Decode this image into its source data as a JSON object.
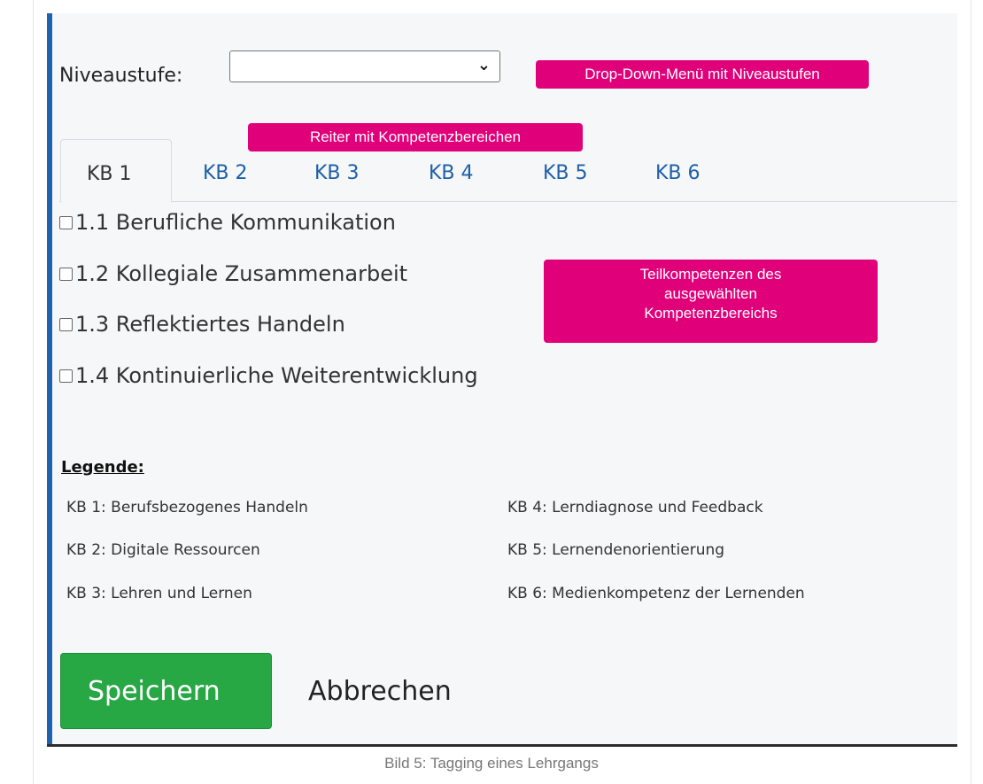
{
  "form": {
    "niveau_label": "Niveaustufe:",
    "niveau_selected": "",
    "tabs": [
      "KB 1",
      "KB 2",
      "KB 3",
      "KB 4",
      "KB 5",
      "KB 6"
    ],
    "active_tab": "KB 1",
    "competences": [
      "1.1 Berufliche Kommunikation",
      "1.2 Kollegiale Zusammenarbeit",
      "1.3 Reflektiertes Handeln",
      "1.4 Kontinuierliche Weiterentwicklung"
    ],
    "legend_title": "Legende:",
    "legend": [
      "KB 1: Berufsbezogenes Handeln",
      "KB 2: Digitale Ressourcen",
      "KB 3: Lehren und Lernen",
      "KB 4: Lerndiagnose und Feedback",
      "KB 5: Lernendenorientierung",
      "KB 6: Medienkompetenz der Lernenden"
    ],
    "save_label": "Speichern",
    "cancel_label": "Abbrechen"
  },
  "callouts": {
    "dropdown": "Drop-Down-Menü mit Niveaustufen",
    "tabs": "Reiter mit Kompetenzbereichen",
    "subcompetences_line1": "Teilkompetenzen des",
    "subcompetences_line2": "ausgewählten",
    "subcompetences_line3": "Kompetenzbereichs"
  },
  "caption": "Bild 5: Tagging eines Lehrgangs",
  "colors": {
    "callout": "#e0007a",
    "save_button": "#28a745",
    "tab_text": "#1f5fa8",
    "accent_bar": "#1f63b0"
  },
  "icons": {
    "dropdown": "chevron-down-icon",
    "checkbox": "checkbox-icon"
  }
}
